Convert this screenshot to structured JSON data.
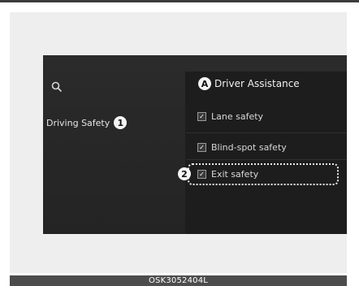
{
  "screen": {
    "left_panel": {
      "search_icon": "search-icon",
      "menu_item_label": "Driving Safety",
      "menu_callout": "1"
    },
    "right_panel": {
      "title": "Driver Assistance",
      "title_callout": "A",
      "options": [
        {
          "label": "Lane safety",
          "checked": true
        },
        {
          "label": "Blind-spot safety",
          "checked": true
        },
        {
          "label": "Exit safety",
          "checked": true
        }
      ],
      "exit_callout": "2"
    }
  },
  "figure_code": "OSK3052404L",
  "colors": {
    "screen_bg": "#1f1f1f",
    "text": "#e6e6e6",
    "highlight": "#eaeaea",
    "footer": "#4c4c4c"
  }
}
